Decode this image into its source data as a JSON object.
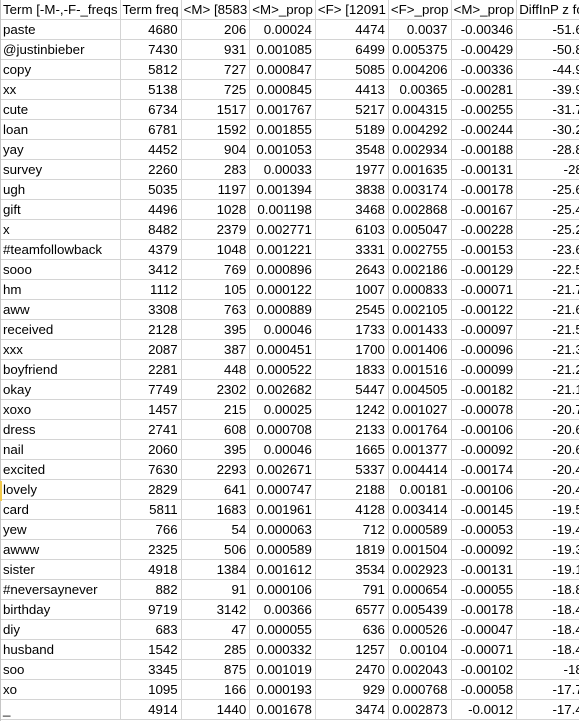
{
  "spreadsheet": {
    "columns": [
      "Term [-M-,-F-_freqs",
      "Term freq",
      "<M> [8583",
      "<M>_prop",
      "<F> [12091",
      "<F>_prop",
      "<M>_prop",
      "DiffInP z fo"
    ],
    "rows": [
      [
        "paste",
        "4680",
        "206",
        "0.00024",
        "4474",
        "0.0037",
        "-0.00346",
        "-51.6"
      ],
      [
        "@justinbieber",
        "7430",
        "931",
        "0.001085",
        "6499",
        "0.005375",
        "-0.00429",
        "-50.8"
      ],
      [
        "copy",
        "5812",
        "727",
        "0.000847",
        "5085",
        "0.004206",
        "-0.00336",
        "-44.9"
      ],
      [
        "xx",
        "5138",
        "725",
        "0.000845",
        "4413",
        "0.00365",
        "-0.00281",
        "-39.9"
      ],
      [
        "cute",
        "6734",
        "1517",
        "0.001767",
        "5217",
        "0.004315",
        "-0.00255",
        "-31.7"
      ],
      [
        "loan",
        "6781",
        "1592",
        "0.001855",
        "5189",
        "0.004292",
        "-0.00244",
        "-30.2"
      ],
      [
        "yay",
        "4452",
        "904",
        "0.001053",
        "3548",
        "0.002934",
        "-0.00188",
        "-28.8"
      ],
      [
        "survey",
        "2260",
        "283",
        "0.00033",
        "1977",
        "0.001635",
        "-0.00131",
        "-28"
      ],
      [
        "ugh",
        "5035",
        "1197",
        "0.001394",
        "3838",
        "0.003174",
        "-0.00178",
        "-25.6"
      ],
      [
        "gift",
        "4496",
        "1028",
        "0.001198",
        "3468",
        "0.002868",
        "-0.00167",
        "-25.4"
      ],
      [
        "x",
        "8482",
        "2379",
        "0.002771",
        "6103",
        "0.005047",
        "-0.00228",
        "-25.2"
      ],
      [
        "#teamfollowback",
        "4379",
        "1048",
        "0.001221",
        "3331",
        "0.002755",
        "-0.00153",
        "-23.6"
      ],
      [
        "sooo",
        "3412",
        "769",
        "0.000896",
        "2643",
        "0.002186",
        "-0.00129",
        "-22.5"
      ],
      [
        "hm",
        "1112",
        "105",
        "0.000122",
        "1007",
        "0.000833",
        "-0.00071",
        "-21.7"
      ],
      [
        "aww",
        "3308",
        "763",
        "0.000889",
        "2545",
        "0.002105",
        "-0.00122",
        "-21.6"
      ],
      [
        "received",
        "2128",
        "395",
        "0.00046",
        "1733",
        "0.001433",
        "-0.00097",
        "-21.5"
      ],
      [
        "xxx",
        "2087",
        "387",
        "0.000451",
        "1700",
        "0.001406",
        "-0.00096",
        "-21.3"
      ],
      [
        "boyfriend",
        "2281",
        "448",
        "0.000522",
        "1833",
        "0.001516",
        "-0.00099",
        "-21.2"
      ],
      [
        "okay",
        "7749",
        "2302",
        "0.002682",
        "5447",
        "0.004505",
        "-0.00182",
        "-21.1"
      ],
      [
        "xoxo",
        "1457",
        "215",
        "0.00025",
        "1242",
        "0.001027",
        "-0.00078",
        "-20.7"
      ],
      [
        "dress",
        "2741",
        "608",
        "0.000708",
        "2133",
        "0.001764",
        "-0.00106",
        "-20.6"
      ],
      [
        "nail",
        "2060",
        "395",
        "0.00046",
        "1665",
        "0.001377",
        "-0.00092",
        "-20.6"
      ],
      [
        "excited",
        "7630",
        "2293",
        "0.002671",
        "5337",
        "0.004414",
        "-0.00174",
        "-20.4"
      ],
      [
        "lovely",
        "2829",
        "641",
        "0.000747",
        "2188",
        "0.00181",
        "-0.00106",
        "-20.4"
      ],
      [
        "card",
        "5811",
        "1683",
        "0.001961",
        "4128",
        "0.003414",
        "-0.00145",
        "-19.5"
      ],
      [
        "yew",
        "766",
        "54",
        "0.000063",
        "712",
        "0.000589",
        "-0.00053",
        "-19.4"
      ],
      [
        "awww",
        "2325",
        "506",
        "0.000589",
        "1819",
        "0.001504",
        "-0.00092",
        "-19.3"
      ],
      [
        "sister",
        "4918",
        "1384",
        "0.001612",
        "3534",
        "0.002923",
        "-0.00131",
        "-19.1"
      ],
      [
        "#neversaynever",
        "882",
        "91",
        "0.000106",
        "791",
        "0.000654",
        "-0.00055",
        "-18.8"
      ],
      [
        "birthday",
        "9719",
        "3142",
        "0.00366",
        "6577",
        "0.005439",
        "-0.00178",
        "-18.4"
      ],
      [
        "diy",
        "683",
        "47",
        "0.000055",
        "636",
        "0.000526",
        "-0.00047",
        "-18.4"
      ],
      [
        "husband",
        "1542",
        "285",
        "0.000332",
        "1257",
        "0.00104",
        "-0.00071",
        "-18.4"
      ],
      [
        "soo",
        "3345",
        "875",
        "0.001019",
        "2470",
        "0.002043",
        "-0.00102",
        "-18"
      ],
      [
        "xo",
        "1095",
        "166",
        "0.000193",
        "929",
        "0.000768",
        "-0.00058",
        "-17.7"
      ],
      [
        "_",
        "4914",
        "1440",
        "0.001678",
        "3474",
        "0.002873",
        "-0.0012",
        "-17.4"
      ]
    ],
    "selected_row_term": "lovely"
  }
}
